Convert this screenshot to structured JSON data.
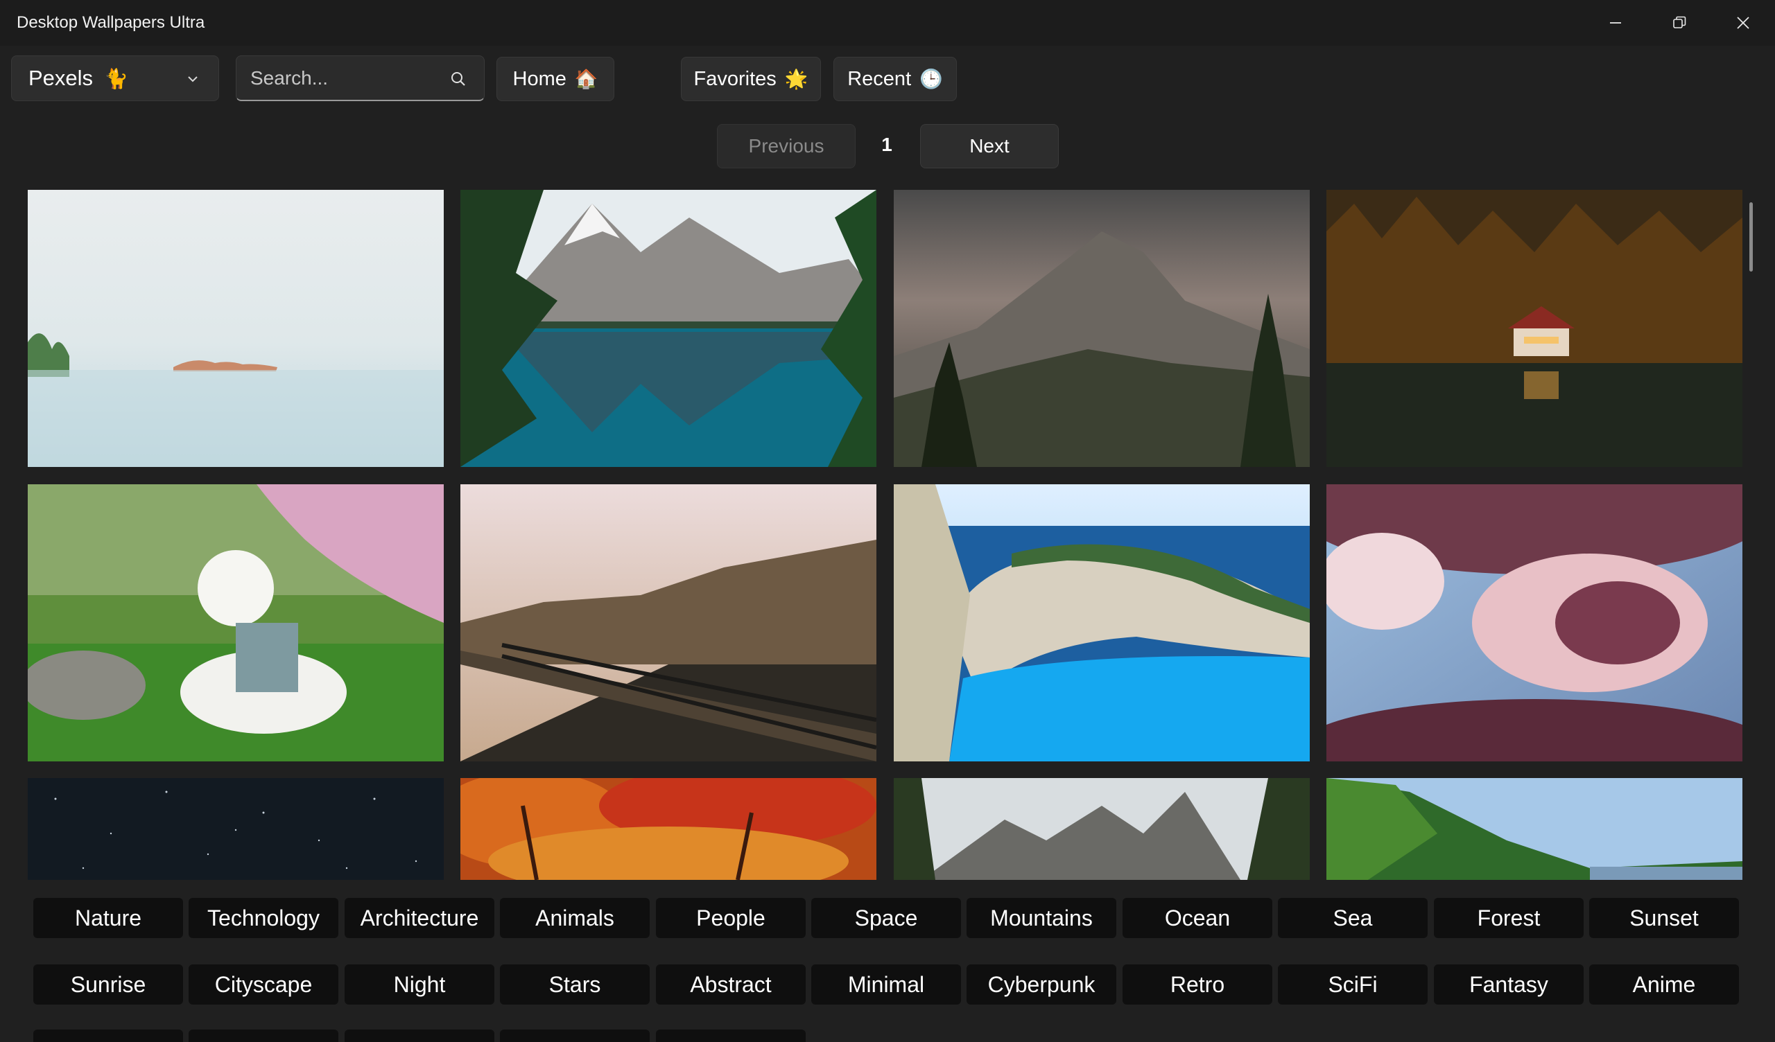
{
  "window": {
    "title": "Desktop Wallpapers Ultra",
    "controls": [
      "minimize-icon",
      "restore-icon",
      "close-icon"
    ]
  },
  "toolbar": {
    "source_label": "Pexels",
    "source_emoji": "🐈",
    "search_placeholder": "Search...",
    "home_label": "Home",
    "home_emoji": "🏠",
    "favorites_label": "Favorites",
    "favorites_emoji": "🌟",
    "recent_label": "Recent",
    "recent_emoji": "🕒"
  },
  "pagination": {
    "previous_label": "Previous",
    "current_page": "1",
    "next_label": "Next",
    "previous_enabled": false
  },
  "gallery": {
    "wallpapers": [
      {
        "scene": "woman-floating-calm-water"
      },
      {
        "scene": "mountain-lake-reflection"
      },
      {
        "scene": "cloudy-mountain-peaks"
      },
      {
        "scene": "lakeside-cabin-forest-night"
      },
      {
        "scene": "white-dog-cherry-blossom"
      },
      {
        "scene": "railway-autumn-forest"
      },
      {
        "scene": "navagio-beach-cove"
      },
      {
        "scene": "pink-clouds-sky"
      },
      {
        "scene": "starry-night-sky"
      },
      {
        "scene": "autumn-red-trees"
      },
      {
        "scene": "rocky-mountains-pines"
      },
      {
        "scene": "green-forest-hillside"
      }
    ]
  },
  "categories": {
    "row1": [
      "Nature",
      "Technology",
      "Architecture",
      "Animals",
      "People",
      "Space",
      "Mountains",
      "Ocean",
      "Sea",
      "Forest",
      "Sunset"
    ],
    "row2": [
      "Sunrise",
      "Cityscape",
      "Night",
      "Stars",
      "Abstract",
      "Minimal",
      "Cyberpunk",
      "Retro",
      "SciFi",
      "Fantasy",
      "Anime"
    ]
  },
  "colors": {
    "background": "#202020",
    "titlebar": "#1c1c1c",
    "button": "#2d2d2d",
    "chip": "#0f0f0f"
  }
}
